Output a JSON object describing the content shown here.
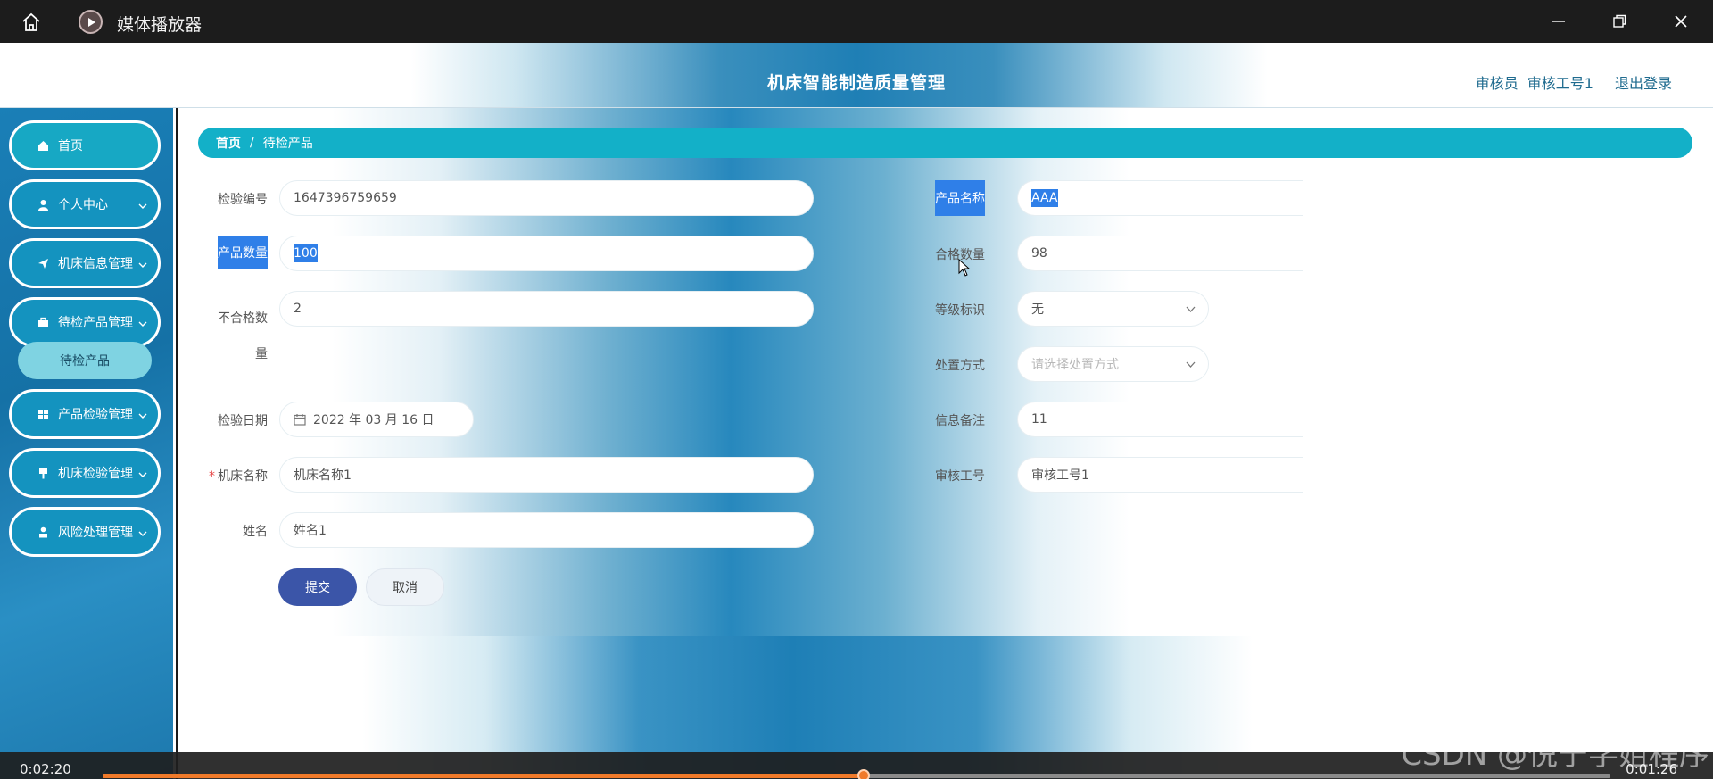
{
  "player": {
    "title": "媒体播放器",
    "time_elapsed": "0:02:20",
    "time_remaining": "0:01:26",
    "progress": 0.505,
    "watermark": "CSDN @悦宁学姐程序"
  },
  "header": {
    "app_title": "机床智能制造质量管理",
    "role": "审核员",
    "user": "审核工号1",
    "logout": "退出登录"
  },
  "sidebar": {
    "items": [
      {
        "label": "首页",
        "icon": "home-icon"
      },
      {
        "label": "个人中心",
        "icon": "user-icon"
      },
      {
        "label": "机床信息管理",
        "icon": "send-icon"
      },
      {
        "label": "待检产品管理",
        "icon": "briefcase-icon"
      },
      {
        "label": "产品检验管理",
        "icon": "grid-icon"
      },
      {
        "label": "机床检验管理",
        "icon": "pin-icon"
      },
      {
        "label": "风险处理管理",
        "icon": "person-icon"
      }
    ],
    "active_sub": "待检产品"
  },
  "breadcrumb": {
    "home": "首页",
    "sep": "/",
    "current": "待检产品"
  },
  "form": {
    "inspection_no": {
      "label": "检验编号",
      "value": "1647396759659"
    },
    "product_name": {
      "label": "产品名称",
      "value": "AAA"
    },
    "product_qty": {
      "label": "产品数量",
      "value": "100"
    },
    "qualified_qty": {
      "label": "合格数量",
      "value": "98"
    },
    "unqualified_qty": {
      "label_line1": "不合格数",
      "label_line2": "量",
      "value": "2"
    },
    "grade": {
      "label": "等级标识",
      "value": "无"
    },
    "disposal": {
      "label": "处置方式",
      "placeholder": "请选择处置方式"
    },
    "inspect_date": {
      "label": "检验日期",
      "value": "2022 年 03 月 16 日"
    },
    "remark": {
      "label": "信息备注",
      "value": "11"
    },
    "machine_name": {
      "label": "机床名称",
      "required": "*",
      "value": "机床名称1"
    },
    "auditor_no": {
      "label": "审核工号",
      "value": "审核工号1"
    },
    "name": {
      "label": "姓名",
      "value": "姓名1"
    },
    "submit": "提交",
    "cancel": "取消"
  }
}
